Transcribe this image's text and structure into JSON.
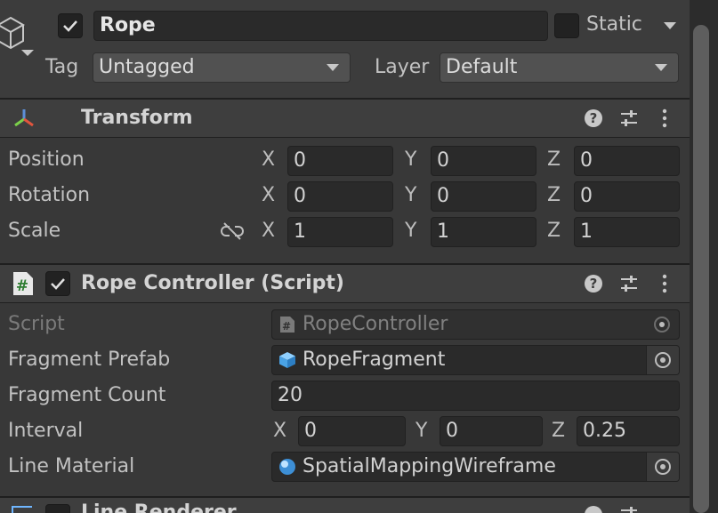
{
  "header": {
    "name": "Rope",
    "static_label": "Static",
    "tag_label": "Tag",
    "tag_value": "Untagged",
    "layer_label": "Layer",
    "layer_value": "Default"
  },
  "transform": {
    "title": "Transform",
    "rows": [
      {
        "label": "Position",
        "x": "0",
        "y": "0",
        "z": "0"
      },
      {
        "label": "Rotation",
        "x": "0",
        "y": "0",
        "z": "0"
      },
      {
        "label": "Scale",
        "x": "1",
        "y": "1",
        "z": "1"
      }
    ],
    "axis_x": "X",
    "axis_y": "Y",
    "axis_z": "Z"
  },
  "rope_controller": {
    "title": "Rope Controller (Script)",
    "script_label": "Script",
    "script_value": "RopeController",
    "fragment_prefab_label": "Fragment Prefab",
    "fragment_prefab_value": "RopeFragment",
    "fragment_count_label": "Fragment Count",
    "fragment_count_value": "20",
    "interval_label": "Interval",
    "interval_x": "0",
    "interval_y": "0",
    "interval_z": "0.25",
    "line_material_label": "Line Material",
    "line_material_value": "SpatialMappingWireframe"
  },
  "next_component": {
    "title": "Line Renderer"
  },
  "colors": {
    "background": "#383838",
    "field": "#2a2a2a",
    "header": "#3e3e3e"
  }
}
